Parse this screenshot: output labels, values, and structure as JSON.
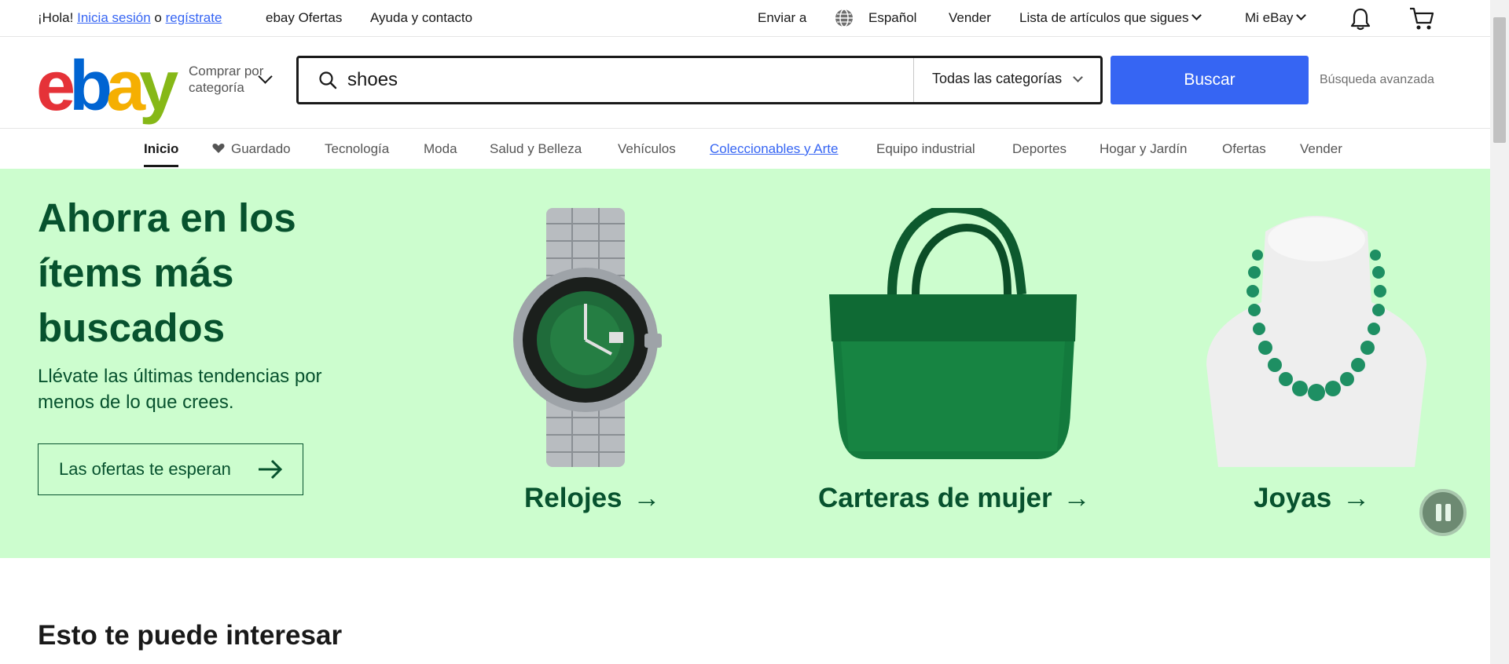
{
  "topbar": {
    "greeting": "¡Hola!",
    "signin": "Inicia sesión",
    "or": "o",
    "register": "regístrate",
    "daily_deals": "ebay Ofertas",
    "help": "Ayuda y contacto",
    "ship_to": "Enviar a",
    "language": "Español",
    "sell": "Vender",
    "watchlist": "Lista de artículos que sigues",
    "my_ebay": "Mi eBay"
  },
  "header": {
    "logo_letters": [
      "e",
      "b",
      "a",
      "y"
    ],
    "logo_colors": [
      "#e53238",
      "#0064d2",
      "#f5af02",
      "#86b817"
    ],
    "shop_by_line1": "Comprar por",
    "shop_by_line2": "categoría",
    "search_value": "shoes",
    "category_select": "Todas las categorías",
    "search_button": "Buscar",
    "advanced_search": "Búsqueda avanzada"
  },
  "nav": {
    "items": [
      {
        "label": "Inicio"
      },
      {
        "label": "Guardado"
      },
      {
        "label": "Tecnología"
      },
      {
        "label": "Moda"
      },
      {
        "label": "Salud y Belleza"
      },
      {
        "label": "Vehículos"
      },
      {
        "label": "Coleccionables y Arte"
      },
      {
        "label": "Equipo industrial"
      },
      {
        "label": "Deportes"
      },
      {
        "label": "Hogar y Jardín"
      },
      {
        "label": "Ofertas"
      },
      {
        "label": "Vender"
      }
    ]
  },
  "hero": {
    "title": "Ahorra en los ítems más buscados",
    "subtitle": "Llévate las últimas tendencias por menos de lo que crees.",
    "cta": "Las ofertas te esperan",
    "cards": [
      {
        "label": "Relojes"
      },
      {
        "label": "Carteras de mujer"
      },
      {
        "label": "Joyas"
      }
    ],
    "bg_color": "#ccfdce",
    "text_color": "#07522e"
  },
  "section": {
    "title": "Esto te puede interesar"
  },
  "colors": {
    "accent": "#3665f3"
  }
}
